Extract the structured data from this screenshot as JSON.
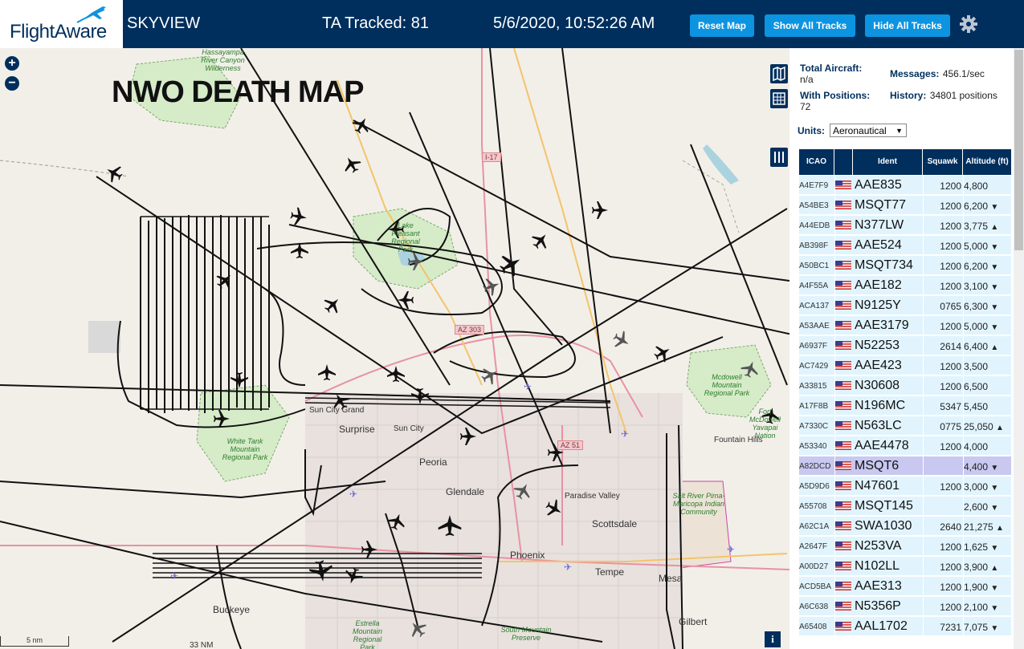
{
  "header": {
    "logo_text": "FlightAware",
    "app_name": "SKYVIEW",
    "tracked": "TA Tracked: 81",
    "clock": "5/6/2020, 10:52:26 AM",
    "buttons": {
      "reset": "Reset Map",
      "show": "Show All Tracks",
      "hide": "Hide All Tracks"
    },
    "settings_icon": "gear-icon"
  },
  "map": {
    "title": "NWO DEATH MAP",
    "zoom_in": "+",
    "zoom_out": "−",
    "scale": "5 nm",
    "info": "i",
    "places": [
      {
        "id": "surprise",
        "text": "Surprise"
      },
      {
        "id": "sun-city",
        "text": "Sun City"
      },
      {
        "id": "peoria",
        "text": "Peoria"
      },
      {
        "id": "glendale",
        "text": "Glendale"
      },
      {
        "id": "paradise-valley",
        "text": "Paradise Valley"
      },
      {
        "id": "scottsdale",
        "text": "Scottsdale"
      },
      {
        "id": "phoenix",
        "text": "Phoenix"
      },
      {
        "id": "tempe",
        "text": "Tempe"
      },
      {
        "id": "mesa",
        "text": "Mesa"
      },
      {
        "id": "gilbert",
        "text": "Gilbert"
      },
      {
        "id": "buckeye",
        "text": "Buckeye"
      },
      {
        "id": "fountain-hills",
        "text": "Fountain Hills"
      },
      {
        "id": "sun-city-grand",
        "text": "Sun City Grand"
      }
    ],
    "parks": [
      {
        "id": "hassayampa",
        "text": "Hassayampa River Canyon Wilderness"
      },
      {
        "id": "lake-pleasant",
        "text": "Lake Pleasant Regional Park"
      },
      {
        "id": "white-tank",
        "text": "White Tank Mountain Regional Park"
      },
      {
        "id": "mcdowell",
        "text": "Mcdowell Mountain Regional Park"
      },
      {
        "id": "fort-mcdowell",
        "text": "Fort McDowell Yavapai Nation"
      },
      {
        "id": "salt-river",
        "text": "Salt River Pima-Maricopa Indian Community"
      },
      {
        "id": "estrella",
        "text": "Estrella Mountain Regional Park"
      },
      {
        "id": "south-mountain",
        "text": "South Mountain Preserve"
      }
    ],
    "roads": {
      "i17": "I-17",
      "az303": "AZ 303",
      "az51": "AZ 51",
      "n33": "33 NM"
    }
  },
  "stats": {
    "total_label": "Total Aircraft:",
    "total_value": "n/a",
    "messages_label": "Messages:",
    "messages_value": "456.1/sec",
    "positions_label": "With Positions:",
    "positions_value": "72",
    "history_label": "History:",
    "history_value": "34801 positions",
    "units_label": "Units:",
    "units_value": "Aeronautical"
  },
  "table": {
    "headers": {
      "icao": "ICAO",
      "ident": "Ident",
      "squawk": "Squawk",
      "altitude": "Altitude (ft)"
    },
    "rows": [
      {
        "icao": "A4E7F9",
        "ident": "AAE835",
        "squawk": "1200",
        "alt": "4,800",
        "trend": ""
      },
      {
        "icao": "A54BE3",
        "ident": "MSQT77",
        "squawk": "1200",
        "alt": "6,200",
        "trend": "▼"
      },
      {
        "icao": "A44EDB",
        "ident": "N377LW",
        "squawk": "1200",
        "alt": "3,775",
        "trend": "▲"
      },
      {
        "icao": "AB398F",
        "ident": "AAE524",
        "squawk": "1200",
        "alt": "5,000",
        "trend": "▼"
      },
      {
        "icao": "A50BC1",
        "ident": "MSQT734",
        "squawk": "1200",
        "alt": "6,200",
        "trend": "▼"
      },
      {
        "icao": "A4F55A",
        "ident": "AAE182",
        "squawk": "1200",
        "alt": "3,100",
        "trend": "▼"
      },
      {
        "icao": "ACA137",
        "ident": "N9125Y",
        "squawk": "0765",
        "alt": "6,300",
        "trend": "▼"
      },
      {
        "icao": "A53AAE",
        "ident": "AAE3179",
        "squawk": "1200",
        "alt": "5,000",
        "trend": "▼"
      },
      {
        "icao": "A6937F",
        "ident": "N52253",
        "squawk": "2614",
        "alt": "6,400",
        "trend": "▲"
      },
      {
        "icao": "AC7429",
        "ident": "AAE423",
        "squawk": "1200",
        "alt": "3,500",
        "trend": ""
      },
      {
        "icao": "A33815",
        "ident": "N30608",
        "squawk": "1200",
        "alt": "6,500",
        "trend": ""
      },
      {
        "icao": "A17F8B",
        "ident": "N196MC",
        "squawk": "5347",
        "alt": "5,450",
        "trend": ""
      },
      {
        "icao": "A7330C",
        "ident": "N563LC",
        "squawk": "0775",
        "alt": "25,050",
        "trend": "▲"
      },
      {
        "icao": "A53340",
        "ident": "AAE4478",
        "squawk": "1200",
        "alt": "4,000",
        "trend": ""
      },
      {
        "icao": "A82DCD",
        "ident": "MSQT6",
        "squawk": "",
        "alt": "4,400",
        "trend": "▼"
      },
      {
        "icao": "A5D9D6",
        "ident": "N47601",
        "squawk": "1200",
        "alt": "3,000",
        "trend": "▼"
      },
      {
        "icao": "A55708",
        "ident": "MSQT145",
        "squawk": "",
        "alt": "2,600",
        "trend": "▼"
      },
      {
        "icao": "A62C1A",
        "ident": "SWA1030",
        "squawk": "2640",
        "alt": "21,275",
        "trend": "▲"
      },
      {
        "icao": "A2647F",
        "ident": "N253VA",
        "squawk": "1200",
        "alt": "1,625",
        "trend": "▼"
      },
      {
        "icao": "A00D27",
        "ident": "N102LL",
        "squawk": "1200",
        "alt": "3,900",
        "trend": "▲"
      },
      {
        "icao": "ACD5BA",
        "ident": "AAE313",
        "squawk": "1200",
        "alt": "1,900",
        "trend": "▼"
      },
      {
        "icao": "A6C638",
        "ident": "N5356P",
        "squawk": "1200",
        "alt": "2,100",
        "trend": "▼"
      },
      {
        "icao": "A65408",
        "ident": "AAL1702",
        "squawk": "7231",
        "alt": "7,075",
        "trend": "▼"
      }
    ],
    "selected_index": 14
  },
  "colors": {
    "navy": "#002f5d",
    "button": "#0d94e0",
    "row": "#e1f4fe",
    "row_selected": "#c8c8f0"
  }
}
